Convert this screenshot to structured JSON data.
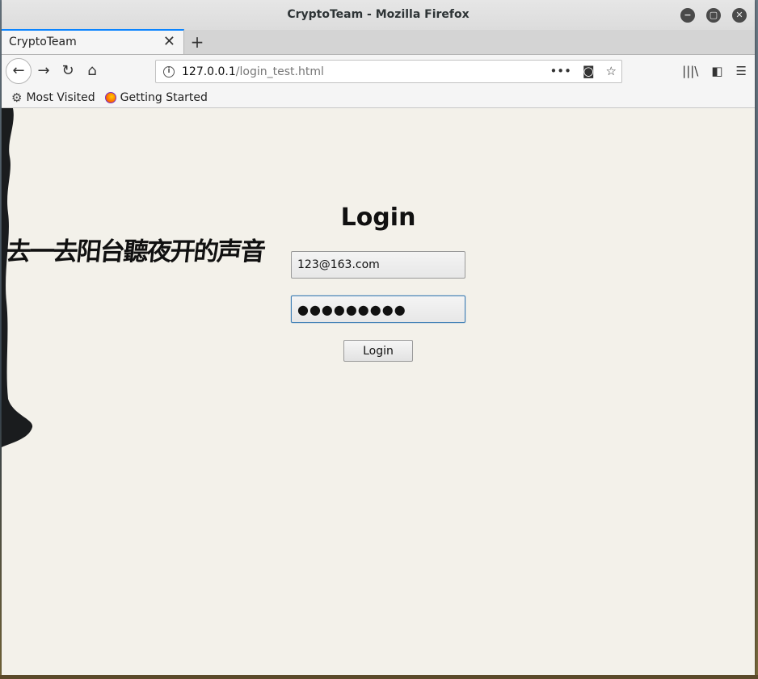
{
  "window": {
    "title": "CryptoTeam - Mozilla Firefox",
    "controls": {
      "minimize": "−",
      "maximize": "▢",
      "close": "✕"
    }
  },
  "tabs": [
    {
      "label": "CryptoTeam",
      "close": "✕"
    }
  ],
  "new_tab": "+",
  "nav": {
    "back": "←",
    "forward": "→",
    "reload": "↻",
    "home": "⌂"
  },
  "urlbar": {
    "host": "127.0.0.1",
    "path": "/login_test.html",
    "more": "•••",
    "pocket": "◙",
    "star": "☆"
  },
  "toolbar_right": {
    "library": "|||\\",
    "sidebar": "◧",
    "menu": "☰"
  },
  "bookmarks": [
    {
      "label": "Most Visited",
      "icon": "gear-icon"
    },
    {
      "label": "Getting Started",
      "icon": "firefox-icon"
    }
  ],
  "page": {
    "calligraphy": "去一去阳台聽夜开的声音",
    "login_title": "Login",
    "email_value": "123@163.com",
    "password_value": "●●●●●●●●●",
    "login_button": "Login"
  },
  "colors": {
    "accent_tab": "#0a84ff",
    "page_background": "#f3f1ea",
    "input_focus": "#3f7fb5"
  }
}
